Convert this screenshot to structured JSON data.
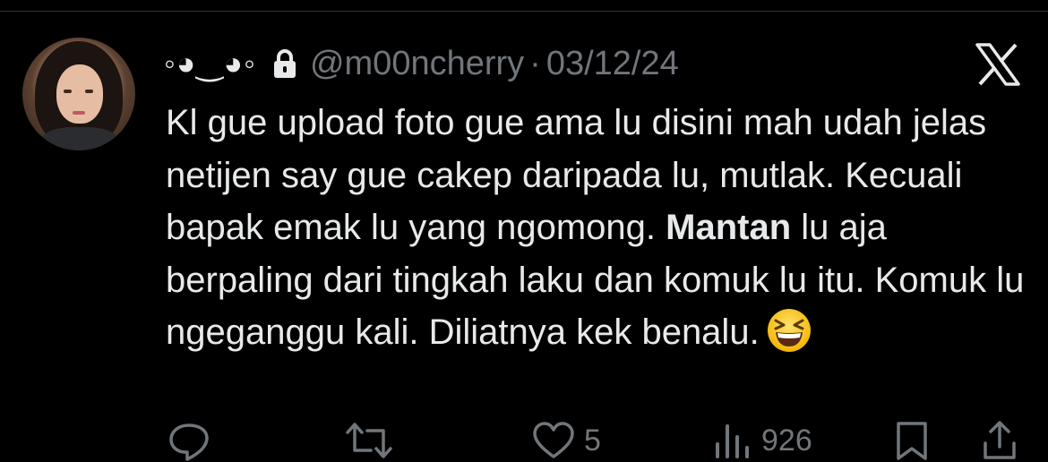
{
  "tweet": {
    "display_name": "◦◕‿◕◦",
    "handle": "@m00ncherry",
    "separator": "·",
    "date": "03/12/24",
    "text_before_bold": "Kl gue upload foto gue ama lu disini mah udah jelas netijen say gue cakep daripada lu, mutlak. Kecuali bapak emak lu yang ngomong. ",
    "text_bold": "Mantan",
    "text_after_bold": " lu aja berpaling dari tingkah laku dan komuk lu itu. Komuk lu ngeganggu kali. Diliatnya kek benalu.",
    "emoji": "laughing-face-emoji"
  },
  "icons": {
    "avatar": "avatar",
    "lock": "lock-icon",
    "x_logo": "x-logo-icon"
  },
  "actions": {
    "reply": {
      "icon": "reply-icon",
      "count": ""
    },
    "retweet": {
      "icon": "retweet-icon",
      "count": ""
    },
    "like": {
      "icon": "heart-icon",
      "count": "5"
    },
    "views": {
      "icon": "views-icon",
      "count": "926"
    },
    "bookmark": {
      "icon": "bookmark-icon",
      "count": ""
    },
    "share": {
      "icon": "share-icon",
      "count": ""
    }
  },
  "colors": {
    "background": "#000000",
    "text_primary": "#e7e9ea",
    "text_secondary": "#71767b",
    "divider": "#2f3336"
  }
}
